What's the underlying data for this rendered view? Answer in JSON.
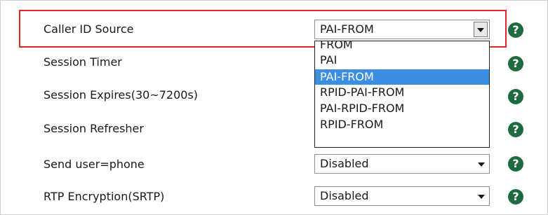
{
  "rows": [
    {
      "label": "Caller ID Source",
      "value": "PAI-FROM",
      "help": "?"
    },
    {
      "label": "Session Timer",
      "value": "",
      "help": "?"
    },
    {
      "label": "Session Expires(30~7200s)",
      "value": "",
      "help": "?"
    },
    {
      "label": "Session Refresher",
      "value": "",
      "help": "?"
    },
    {
      "label": "Send user=phone",
      "value": "Disabled",
      "help": "?"
    },
    {
      "label": "RTP Encryption(SRTP)",
      "value": "Disabled",
      "help": "?"
    }
  ],
  "dropdown": {
    "options": [
      "FROM",
      "PAI",
      "PAI-FROM",
      "RPID-PAI-FROM",
      "PAI-RPID-FROM",
      "RPID-FROM"
    ],
    "selected_index": 2
  },
  "colors": {
    "highlight_border": "#e0272c",
    "help_icon": "#1f6a3f",
    "selected_option": "#3d8ee0"
  },
  "icons": {
    "help": "question-circle-icon",
    "dropdown": "chevron-down-icon"
  }
}
